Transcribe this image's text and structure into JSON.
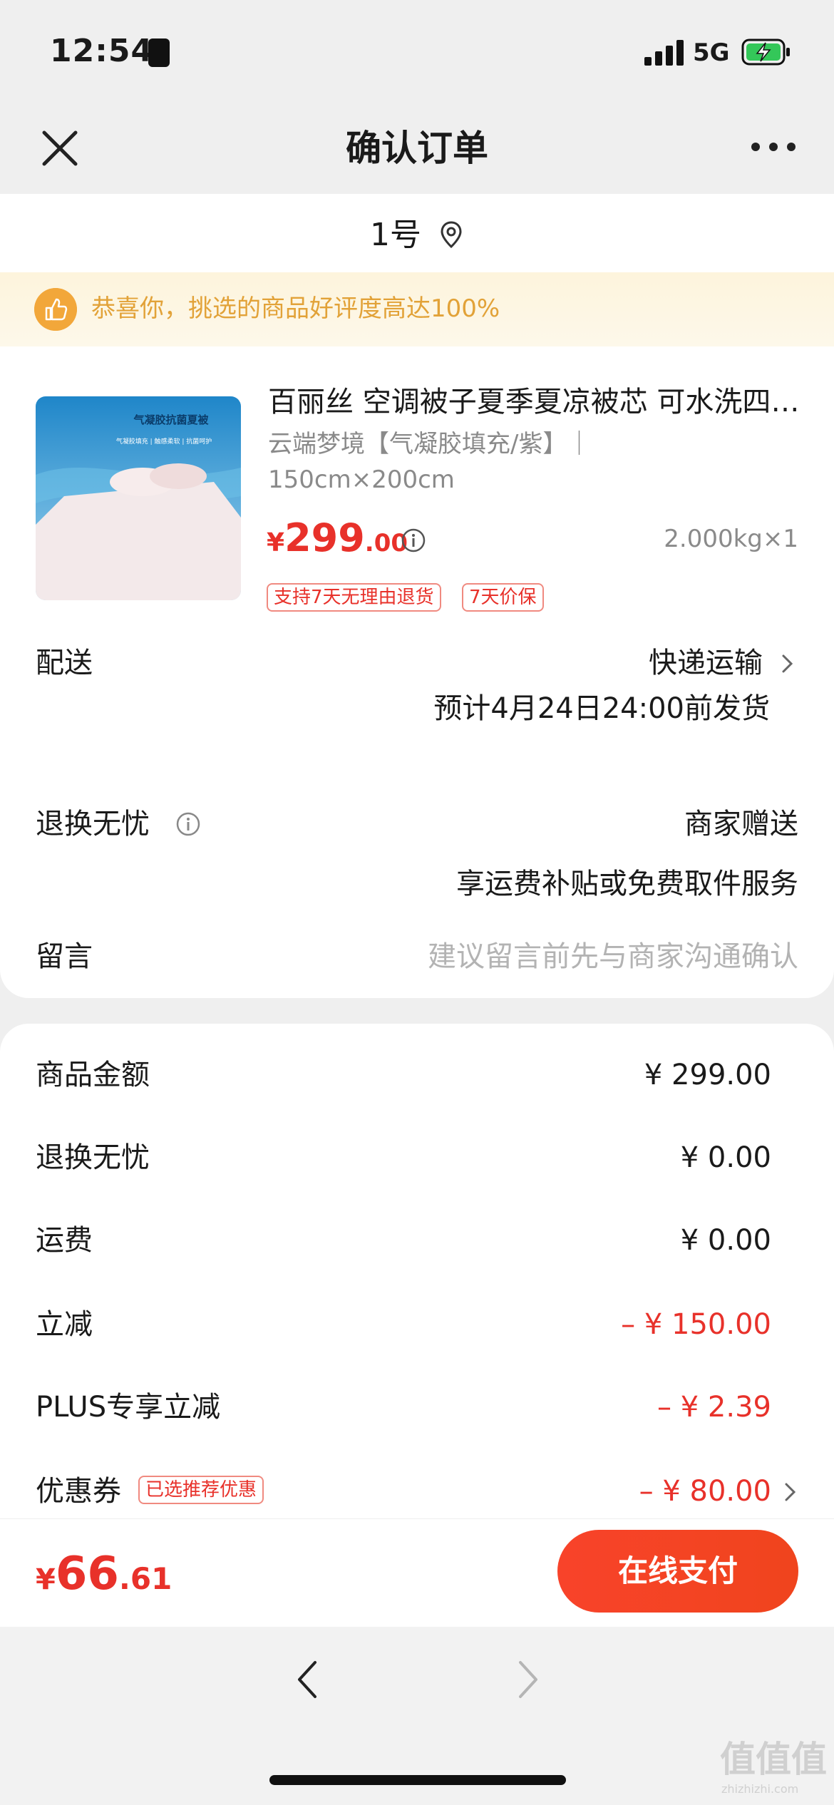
{
  "status_bar": {
    "time": "12:54",
    "network": "5G"
  },
  "nav": {
    "title": "确认订单"
  },
  "store": {
    "name": "1号"
  },
  "banner": {
    "text": "恭喜你，挑选的商品好评度高达100%"
  },
  "product": {
    "title": "百丽丝 空调被子夏季夏凉被芯 可水洗四季被 双人",
    "spec_line1": "云端梦境【气凝胶填充/紫】｜",
    "spec_line2": "150cm×200cm",
    "image_text_1": "气凝胶抗菌夏被",
    "image_text_2": "气凝胶填充 | 触感柔软 | 抗菌呵护",
    "price_symbol": "¥",
    "price_int": "299",
    "price_dec": ".00",
    "weight_qty": "2.000kg×1",
    "tags": [
      "支持7天无理由退货",
      "7天价保"
    ]
  },
  "delivery": {
    "label": "配送",
    "method": "快递运输",
    "estimate": "预计4月24日24:00前发货"
  },
  "returns": {
    "label": "退换无忧",
    "value": "商家赠送",
    "desc": "享运费补贴或免费取件服务"
  },
  "message": {
    "label": "留言",
    "placeholder": "建议留言前先与商家沟通确认"
  },
  "summary": {
    "rows": [
      {
        "label": "商品金额",
        "value": "¥ 299.00"
      },
      {
        "label": "退换无忧",
        "value": "¥ 0.00"
      },
      {
        "label": "运费",
        "value": "¥ 0.00"
      },
      {
        "label": "立减",
        "value": "– ¥ 150.00"
      },
      {
        "label": "PLUS专享立减",
        "value": "– ¥ 2.39"
      },
      {
        "label": "优惠券",
        "value": "– ¥ 80.00"
      }
    ],
    "coupon_tag": "已选推荐优惠"
  },
  "bottom": {
    "symbol": "¥",
    "total_int": "66",
    "total_dec": ".61",
    "pay_label": "在线支付"
  },
  "watermark": {
    "main": "值值值",
    "sub": "zhizhizhi.com"
  },
  "colors": {
    "accent": "#e8312a",
    "banner_text": "#e2a238",
    "banner_bg": "#fdf6e3"
  }
}
